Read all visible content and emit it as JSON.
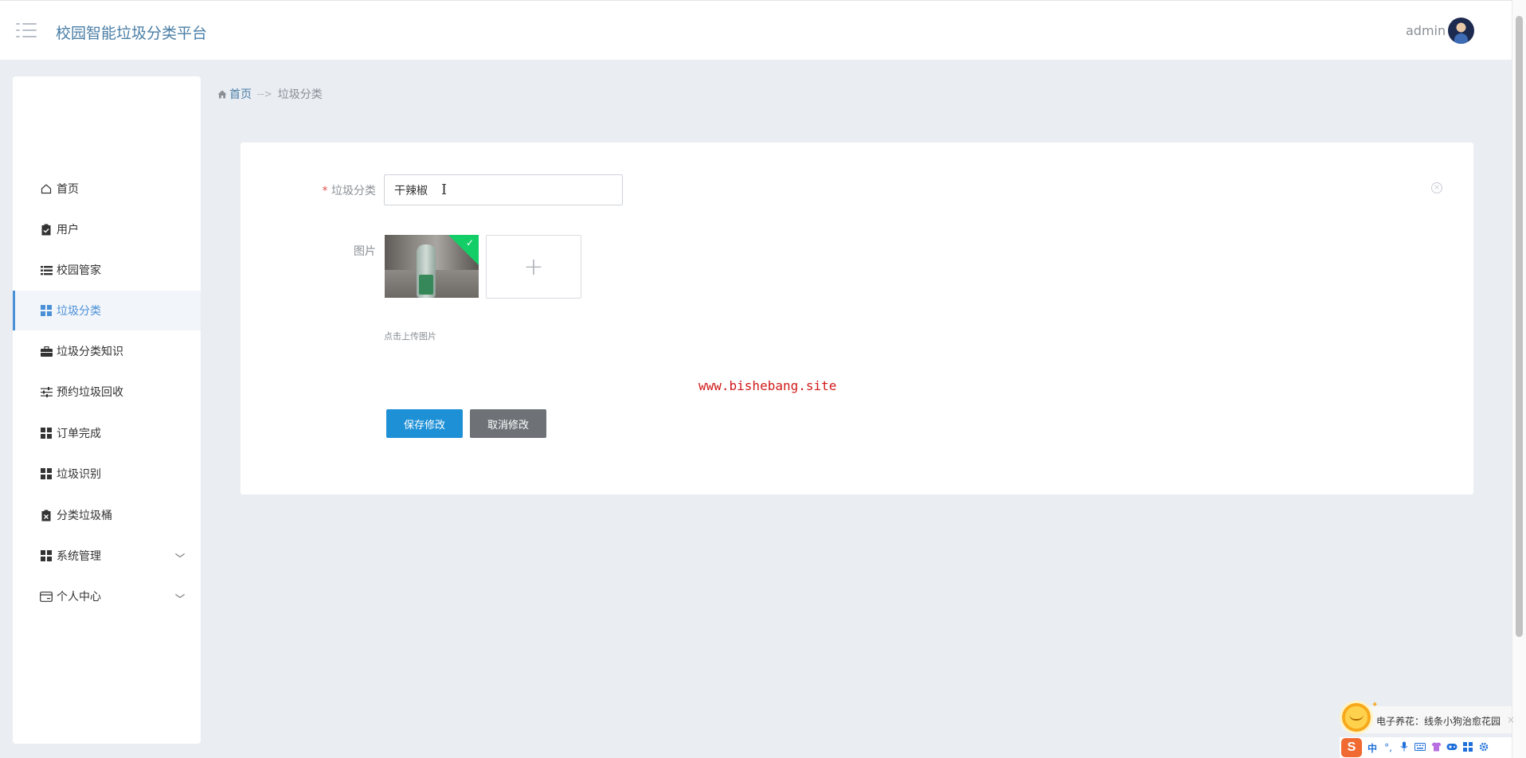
{
  "header": {
    "app_title": "校园智能垃圾分类平台",
    "user_name": "admin"
  },
  "sidebar": {
    "items": [
      {
        "label": "首页",
        "icon": "home-icon",
        "active": false
      },
      {
        "label": "用户",
        "icon": "clipboard-check-icon",
        "active": false
      },
      {
        "label": "校园管家",
        "icon": "list-icon",
        "active": false
      },
      {
        "label": "垃圾分类",
        "icon": "grid-icon",
        "active": true
      },
      {
        "label": "垃圾分类知识",
        "icon": "briefcase-icon",
        "active": false
      },
      {
        "label": "预约垃圾回收",
        "icon": "sliders-icon",
        "active": false
      },
      {
        "label": "订单完成",
        "icon": "grid-icon",
        "active": false
      },
      {
        "label": "垃圾识别",
        "icon": "grid-icon",
        "active": false
      },
      {
        "label": "分类垃圾桶",
        "icon": "clipboard-x-icon",
        "active": false
      },
      {
        "label": "系统管理",
        "icon": "grid-icon",
        "active": false,
        "expandable": true
      },
      {
        "label": "个人中心",
        "icon": "card-icon",
        "active": false,
        "expandable": true
      }
    ]
  },
  "breadcrumb": {
    "home": "首页",
    "separator": "-->",
    "current": "垃圾分类"
  },
  "form": {
    "required_mark": "*",
    "category_label": "垃圾分类",
    "category_value": "干辣椒",
    "image_label": "图片",
    "upload_hint": "点击上传图片",
    "save_label": "保存修改",
    "cancel_label": "取消修改"
  },
  "watermark": "www.bishebang.site",
  "ime": {
    "logo": "S",
    "popup_text": "电子养花：线条小狗治愈花园",
    "close": "×",
    "lang": "中",
    "punct": "°,"
  },
  "colors": {
    "accent": "#4a90d6",
    "title": "#4a7ea6",
    "save_button": "#1e90d6",
    "cancel_button": "#6e7277",
    "upload_success": "#13ce66",
    "watermark": "#d11a1a"
  }
}
